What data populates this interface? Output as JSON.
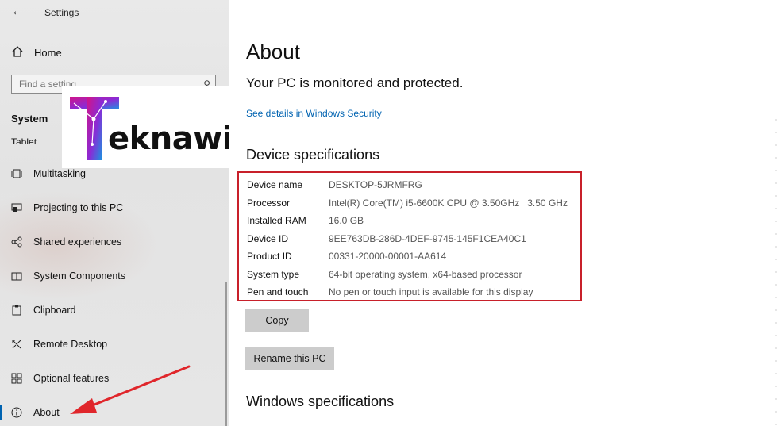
{
  "app": {
    "title": "Settings"
  },
  "sidebar": {
    "home": "Home",
    "search_placeholder": "Find a setting",
    "section": "System",
    "partial_item": "Tablet",
    "items": [
      {
        "label": "Multitasking",
        "icon": "multitasking-icon"
      },
      {
        "label": "Projecting to this PC",
        "icon": "projecting-icon"
      },
      {
        "label": "Shared experiences",
        "icon": "shared-experiences-icon"
      },
      {
        "label": "System Components",
        "icon": "system-components-icon"
      },
      {
        "label": "Clipboard",
        "icon": "clipboard-icon"
      },
      {
        "label": "Remote Desktop",
        "icon": "remote-desktop-icon"
      },
      {
        "label": "Optional features",
        "icon": "optional-features-icon"
      },
      {
        "label": "About",
        "icon": "info-icon",
        "active": true
      }
    ]
  },
  "watermark": {
    "text": "Teknawi"
  },
  "main": {
    "title": "About",
    "status": "Your PC is monitored and protected.",
    "security_link": "See details in Windows Security",
    "device_specs_heading": "Device specifications",
    "specs": [
      {
        "key": "Device name",
        "value": "DESKTOP-5JRMFRG"
      },
      {
        "key": "Processor",
        "value": "Intel(R) Core(TM) i5-6600K CPU @ 3.50GHz   3.50 GHz"
      },
      {
        "key": "Installed RAM",
        "value": "16.0 GB"
      },
      {
        "key": "Device ID",
        "value": "9EE763DB-286D-4DEF-9745-145F1CEA40C1"
      },
      {
        "key": "Product ID",
        "value": "00331-20000-00001-AA614"
      },
      {
        "key": "System type",
        "value": "64-bit operating system, x64-based processor"
      },
      {
        "key": "Pen and touch",
        "value": "No pen or touch input is available for this display"
      }
    ],
    "copy_button": "Copy",
    "rename_button": "Rename this PC",
    "windows_specs_heading": "Windows specifications"
  },
  "colors": {
    "accent": "#0063b1",
    "highlight_box": "#c8202a",
    "arrow": "#e0262b"
  }
}
